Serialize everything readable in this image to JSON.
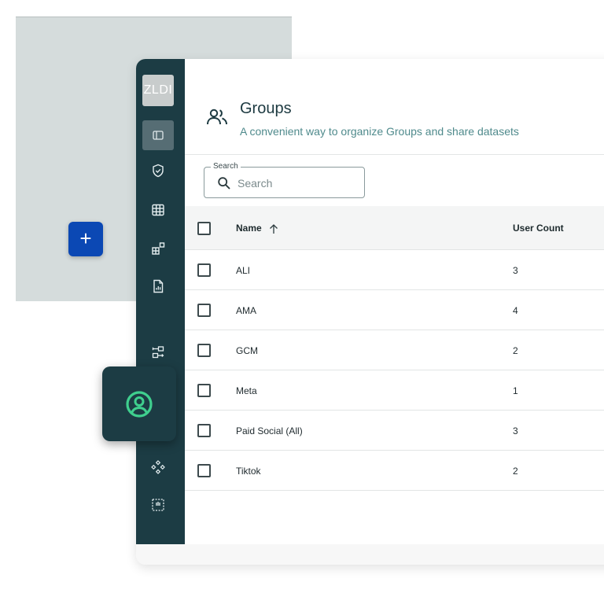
{
  "sidebar": {
    "logo_text": "ZLDI",
    "items": [
      {
        "icon": "panel-toggle-icon",
        "active": true
      },
      {
        "icon": "shield-check-icon"
      },
      {
        "icon": "table-icon"
      },
      {
        "icon": "blocks-icon"
      },
      {
        "icon": "report-file-icon"
      },
      {
        "icon": "workflow-icon"
      },
      {
        "icon": "user-circle-icon",
        "highlighted": true
      },
      {
        "icon": "diamonds-icon"
      },
      {
        "icon": "dashed-frame-icon"
      }
    ]
  },
  "fab": {
    "label": "+"
  },
  "header": {
    "title": "Groups",
    "subtitle": "A convenient way to organize Groups and share datasets",
    "icon": "users-icon"
  },
  "search": {
    "legend": "Search",
    "placeholder": "Search",
    "value": ""
  },
  "table": {
    "columns": {
      "name": "Name",
      "user_count": "User Count"
    },
    "sort": {
      "column": "name",
      "direction": "ascending"
    },
    "rows": [
      {
        "name": "ALI",
        "user_count": "3"
      },
      {
        "name": "AMA",
        "user_count": "4"
      },
      {
        "name": "GCM",
        "user_count": "2"
      },
      {
        "name": "Meta",
        "user_count": "1"
      },
      {
        "name": "Paid Social (All)",
        "user_count": "3"
      },
      {
        "name": "Tiktok",
        "user_count": "2"
      }
    ]
  },
  "colors": {
    "sidebar": "#1c3c44",
    "accent_green": "#3fcf8e",
    "fab_blue": "#0b48b4",
    "subtitle_teal": "#4f8a8c"
  }
}
